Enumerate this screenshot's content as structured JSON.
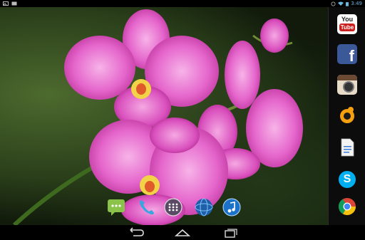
{
  "status_bar": {
    "time": "3:49",
    "left_icons": [
      "picture-icon",
      "screenshot-icon"
    ],
    "right_icons": [
      "alarm-icon",
      "wifi-icon",
      "battery-icon"
    ]
  },
  "right_dock": {
    "apps": [
      {
        "name": "youtube-app-icon",
        "label": "You",
        "sublabel": "Tube",
        "color": "#cc1f1f"
      },
      {
        "name": "facebook-app-icon",
        "label": "f",
        "color": "#3b5998"
      },
      {
        "name": "instagram-app-icon",
        "color": "#8a6a4a"
      },
      {
        "name": "chat-app-icon",
        "color": "#f5a10f"
      },
      {
        "name": "document-app-icon",
        "color": "#3a7bd5"
      },
      {
        "name": "skype-app-icon",
        "label": "S",
        "color": "#00aff0"
      },
      {
        "name": "chrome-app-icon",
        "color": "#db4437"
      }
    ]
  },
  "hotseat": {
    "apps": [
      "messaging-app-icon",
      "phone-app-icon",
      "app-drawer-icon",
      "browser-app-icon",
      "music-app-icon"
    ]
  },
  "nav": {
    "buttons": [
      "back-button",
      "home-button",
      "recents-button"
    ]
  }
}
